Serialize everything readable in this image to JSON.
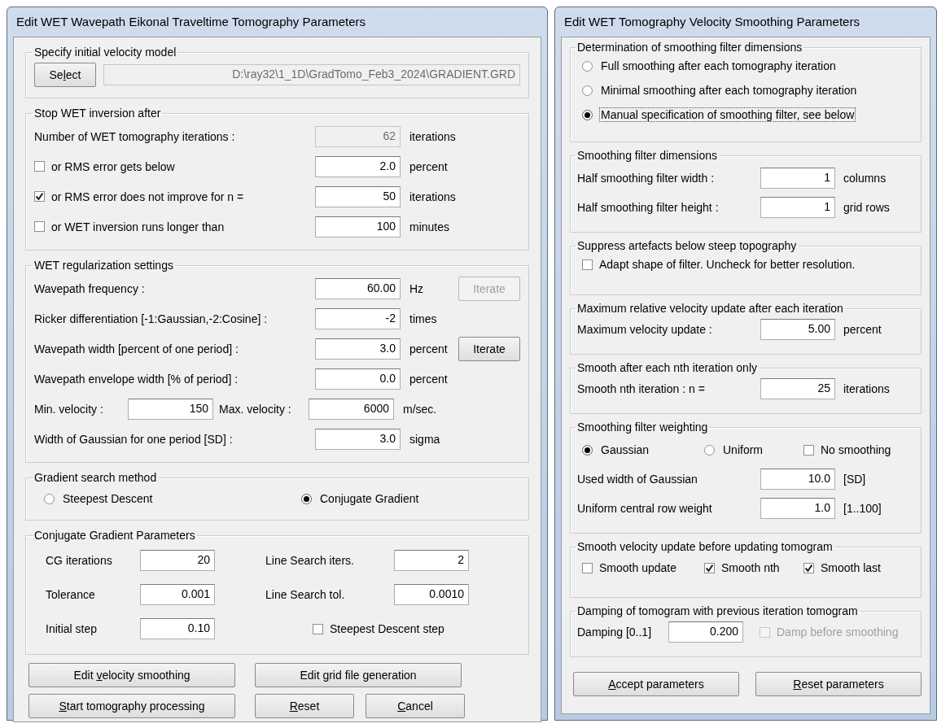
{
  "windows": [
    {
      "title": "Edit WET Wavepath Eikonal Traveltime Tomography Parameters",
      "groups": [
        {
          "legend": "Specify initial velocity model",
          "rows": [
            {
              "kind": "path",
              "items": [
                {
                  "kind": "button",
                  "pre": "Se",
                  "key": "l",
                  "post": "ect",
                  "disabled": false
                },
                {
                  "kind": "field",
                  "value": "D:\\ray32\\1_1D\\GradTomo_Feb3_2024\\GRADIENT.GRD",
                  "disabled": true
                }
              ]
            }
          ]
        },
        {
          "legend": "Stop WET inversion after",
          "rows": [
            {
              "kind": "entry",
              "items": [
                {
                  "kind": "label",
                  "text": "Number of WET tomography iterations :"
                },
                {
                  "kind": "field",
                  "value": "62",
                  "disabled": true
                },
                {
                  "kind": "unit",
                  "text": "iterations"
                }
              ]
            },
            {
              "kind": "entry",
              "items": [
                {
                  "kind": "checkbox",
                  "text": "or RMS error gets below",
                  "checked": false,
                  "disabled": false
                },
                {
                  "kind": "field",
                  "value": "2.0",
                  "disabled": false
                },
                {
                  "kind": "unit",
                  "text": "percent"
                }
              ]
            },
            {
              "kind": "entry",
              "items": [
                {
                  "kind": "checkbox",
                  "text": "or RMS error does not improve for n =",
                  "checked": true,
                  "disabled": false
                },
                {
                  "kind": "field",
                  "value": "50",
                  "disabled": false
                },
                {
                  "kind": "unit",
                  "text": "iterations"
                }
              ]
            },
            {
              "kind": "entry",
              "items": [
                {
                  "kind": "checkbox",
                  "text": "or WET inversion runs longer than",
                  "checked": false,
                  "disabled": false
                },
                {
                  "kind": "field",
                  "value": "100",
                  "disabled": false
                },
                {
                  "kind": "unit",
                  "text": "minutes"
                }
              ]
            }
          ]
        },
        {
          "legend": "WET regularization settings",
          "rows": [
            {
              "kind": "entry",
              "items": [
                {
                  "kind": "label",
                  "text": "Wavepath frequency :"
                },
                {
                  "kind": "field",
                  "value": "60.00",
                  "disabled": false
                },
                {
                  "kind": "unit",
                  "text": "Hz"
                },
                {
                  "kind": "button",
                  "pre": "Iterate",
                  "disabled": true
                }
              ]
            },
            {
              "kind": "entry",
              "items": [
                {
                  "kind": "label",
                  "text": "Ricker differentiation [-1:Gaussian,-2:Cosine] :"
                },
                {
                  "kind": "field",
                  "value": "-2",
                  "disabled": false
                },
                {
                  "kind": "unit",
                  "text": "times"
                }
              ]
            },
            {
              "kind": "entry",
              "items": [
                {
                  "kind": "label",
                  "text": "Wavepath width [percent of one period] :"
                },
                {
                  "kind": "field",
                  "value": "3.0",
                  "disabled": false
                },
                {
                  "kind": "unit",
                  "text": "percent"
                },
                {
                  "kind": "button",
                  "pre": "Iterate",
                  "disabled": false
                }
              ]
            },
            {
              "kind": "entry",
              "items": [
                {
                  "kind": "label",
                  "text": "Wavepath envelope width [% of period] :"
                },
                {
                  "kind": "field",
                  "value": "0.0",
                  "disabled": false
                },
                {
                  "kind": "unit",
                  "text": "percent"
                }
              ]
            },
            {
              "kind": "pair",
              "items": [
                {
                  "kind": "label",
                  "text": "Min. velocity :"
                },
                {
                  "kind": "field",
                  "value": "150",
                  "disabled": false
                },
                {
                  "kind": "label",
                  "text": "Max. velocity :"
                },
                {
                  "kind": "field",
                  "value": "6000",
                  "disabled": false
                },
                {
                  "kind": "unit",
                  "text": "m/sec."
                }
              ]
            },
            {
              "kind": "entry",
              "items": [
                {
                  "kind": "label",
                  "text": "Width of Gaussian for one period [SD] :"
                },
                {
                  "kind": "field",
                  "value": "3.0",
                  "disabled": false
                },
                {
                  "kind": "unit",
                  "text": "sigma"
                }
              ]
            }
          ]
        },
        {
          "legend": "Gradient search method",
          "rows": [
            {
              "kind": "two",
              "items": [
                {
                  "kind": "radio",
                  "text": "Steepest Descent",
                  "selected": false
                },
                {
                  "kind": "radio",
                  "text": "Conjugate Gradient",
                  "selected": true
                }
              ]
            }
          ]
        },
        {
          "legend": "Conjugate Gradient Parameters",
          "rows": [
            {
              "kind": "cg",
              "items": [
                {
                  "kind": "label",
                  "text": "CG iterations"
                },
                {
                  "kind": "field",
                  "value": "20",
                  "disabled": false
                },
                {
                  "kind": "label",
                  "text": "Line Search iters."
                },
                {
                  "kind": "field",
                  "value": "2",
                  "disabled": false
                }
              ]
            },
            {
              "kind": "cg",
              "items": [
                {
                  "kind": "label",
                  "text": "Tolerance"
                },
                {
                  "kind": "field",
                  "value": "0.001",
                  "disabled": false
                },
                {
                  "kind": "label",
                  "text": "Line Search tol."
                },
                {
                  "kind": "field",
                  "value": "0.0010",
                  "disabled": false
                }
              ]
            },
            {
              "kind": "cg",
              "items": [
                {
                  "kind": "label",
                  "text": "Initial step"
                },
                {
                  "kind": "field",
                  "value": "0.10",
                  "disabled": false
                },
                {
                  "kind": "checkbox",
                  "text": "Steepest Descent step",
                  "checked": false,
                  "disabled": false
                }
              ]
            }
          ]
        }
      ],
      "button_rows": [
        [
          {
            "pre": "Edit ",
            "key": "v",
            "post": "elocity smoothing",
            "kind": "wide"
          },
          {
            "pre": "Edit ",
            "key": "g",
            "post": "rid file generation",
            "kind": "wide"
          }
        ],
        [
          {
            "key": "S",
            "post": "tart tomography processing",
            "kind": "wide"
          },
          {
            "key": "R",
            "post": "eset",
            "kind": "half"
          },
          {
            "key": "C",
            "post": "ancel",
            "kind": "half"
          }
        ]
      ]
    },
    {
      "title": "Edit WET Tomography Velocity Smoothing Parameters",
      "groups": [
        {
          "legend": "Determination of smoothing filter dimensions",
          "rows": [
            {
              "kind": "stack",
              "items": [
                {
                  "kind": "radio",
                  "text": "Full smoothing after each tomography iteration",
                  "selected": false,
                  "focused": false
                }
              ]
            },
            {
              "kind": "stack",
              "items": [
                {
                  "kind": "radio",
                  "text": "Minimal smoothing after each tomography iteration",
                  "selected": false,
                  "focused": false
                }
              ]
            },
            {
              "kind": "stack",
              "items": [
                {
                  "kind": "radio",
                  "text": "Manual specification of smoothing filter, see below",
                  "selected": true,
                  "focused": true
                }
              ]
            }
          ]
        },
        {
          "legend": "Smoothing filter dimensions",
          "rows": [
            {
              "kind": "entry",
              "items": [
                {
                  "kind": "label",
                  "text": "Half smoothing filter width :"
                },
                {
                  "kind": "field",
                  "value": "1",
                  "disabled": false
                },
                {
                  "kind": "unit",
                  "text": "columns"
                }
              ]
            },
            {
              "kind": "entry",
              "items": [
                {
                  "kind": "label",
                  "text": "Half smoothing filter height :"
                },
                {
                  "kind": "field",
                  "value": "1",
                  "disabled": false
                },
                {
                  "kind": "unit",
                  "text": "grid rows"
                }
              ]
            }
          ]
        },
        {
          "legend": "Suppress artefacts below steep topography",
          "rows": [
            {
              "kind": "stack",
              "items": [
                {
                  "kind": "checkbox",
                  "text": "Adapt shape of filter. Uncheck for better resolution.",
                  "checked": false,
                  "disabled": false
                }
              ]
            }
          ]
        },
        {
          "legend": "Maximum relative velocity update after each iteration",
          "rows": [
            {
              "kind": "entry",
              "items": [
                {
                  "kind": "label",
                  "text": "Maximum velocity update :"
                },
                {
                  "kind": "field",
                  "value": "5.00",
                  "disabled": false
                },
                {
                  "kind": "unit",
                  "text": "percent"
                }
              ]
            }
          ]
        },
        {
          "legend": "Smooth after each nth iteration only",
          "rows": [
            {
              "kind": "entry",
              "items": [
                {
                  "kind": "label",
                  "text": "Smooth nth iteration : n ="
                },
                {
                  "kind": "field",
                  "value": "25",
                  "disabled": false
                },
                {
                  "kind": "unit",
                  "text": "iterations"
                }
              ]
            }
          ]
        },
        {
          "legend": "Smoothing filter weighting",
          "rows": [
            {
              "kind": "three",
              "items": [
                {
                  "kind": "radio",
                  "text": "Gaussian",
                  "selected": true,
                  "focused": false
                },
                {
                  "kind": "radio",
                  "text": "Uniform",
                  "selected": false,
                  "focused": false
                },
                {
                  "kind": "checkbox",
                  "text": "No smoothing",
                  "checked": false,
                  "disabled": false
                }
              ]
            },
            {
              "kind": "entry",
              "items": [
                {
                  "kind": "label",
                  "text": "Used width of Gaussian"
                },
                {
                  "kind": "field",
                  "value": "10.0",
                  "disabled": false
                },
                {
                  "kind": "unit",
                  "text": "[SD]"
                }
              ]
            },
            {
              "kind": "entry",
              "items": [
                {
                  "kind": "label",
                  "text": "Uniform central row weight"
                },
                {
                  "kind": "field",
                  "value": "1.0",
                  "disabled": false
                },
                {
                  "kind": "unit",
                  "text": "[1..100]"
                }
              ]
            }
          ]
        },
        {
          "legend": "Smooth velocity update before updating tomogram",
          "rows": [
            {
              "kind": "three",
              "items": [
                {
                  "kind": "checkbox",
                  "text": "Smooth update",
                  "checked": false,
                  "disabled": false
                },
                {
                  "kind": "checkbox",
                  "text": "Smooth nth",
                  "checked": true,
                  "disabled": false
                },
                {
                  "kind": "checkbox",
                  "text": "Smooth last",
                  "checked": true,
                  "disabled": false
                }
              ]
            }
          ]
        },
        {
          "legend": "Damping of tomogram with previous iteration tomogram",
          "rows": [
            {
              "kind": "damping",
              "items": [
                {
                  "kind": "label",
                  "text": "Damping [0..1]"
                },
                {
                  "kind": "field",
                  "value": "0.200",
                  "disabled": false
                },
                {
                  "kind": "checkbox",
                  "text": "Damp before smoothing",
                  "checked": false,
                  "disabled": true
                }
              ]
            }
          ]
        }
      ],
      "button_rows": [
        [
          {
            "key": "A",
            "post": "ccept parameters",
            "kind": "wide"
          },
          {
            "key": "R",
            "post": "eset parameters",
            "kind": "wide"
          }
        ]
      ]
    }
  ]
}
